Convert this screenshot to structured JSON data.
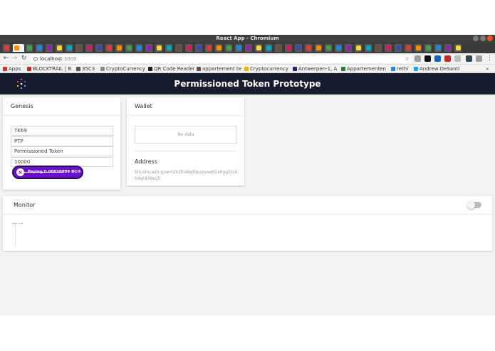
{
  "window": {
    "title": "React App - Chromium"
  },
  "browser": {
    "address": {
      "host": "localhost",
      "port": ":3000"
    },
    "bookmarks": [
      {
        "label": "Apps",
        "color": "#d93025"
      },
      {
        "label": "BLOCKTRAIL | B",
        "color": "#c62828"
      },
      {
        "label": "35C3",
        "color": "#555555"
      },
      {
        "label": "CryptoCurrency",
        "color": "#8a8a8a"
      },
      {
        "label": "QR Code Reader",
        "color": "#222222"
      },
      {
        "label": "appartement te",
        "color": "#6d4c41"
      },
      {
        "label": "Cryptocurrency",
        "color": "#f4b400"
      },
      {
        "label": "Antwerpen-1, A",
        "color": "#1a237e"
      },
      {
        "label": "Appartementen",
        "color": "#2e7d32"
      },
      {
        "label": "rethi",
        "color": "#1e88e5"
      },
      {
        "label": "Andrew DeSanti",
        "color": "#1da1f2"
      }
    ]
  },
  "app": {
    "title": "Permissioned Token Prototype",
    "colors": {
      "header": "#171b2e",
      "accent": "#6a0fd0"
    },
    "genesis": {
      "heading": "Genesis",
      "fields": [
        "TK69",
        "PTP",
        "Permissioned Token",
        "10000"
      ],
      "pay_button": {
        "label": "Paying 0.00020899 BCH",
        "icon": "close-icon",
        "progress": 0.7
      }
    },
    "wallet": {
      "heading": "Wallet",
      "empty_text": "No data",
      "address_label": "Address",
      "address_value": "bitcoincash:qzwnl2k2lh48qfdpzqvse62e9yg2tsdh4qr439eij5"
    },
    "monitor": {
      "heading": "Monitor",
      "output": "... ...",
      "toggle_on": false
    }
  }
}
